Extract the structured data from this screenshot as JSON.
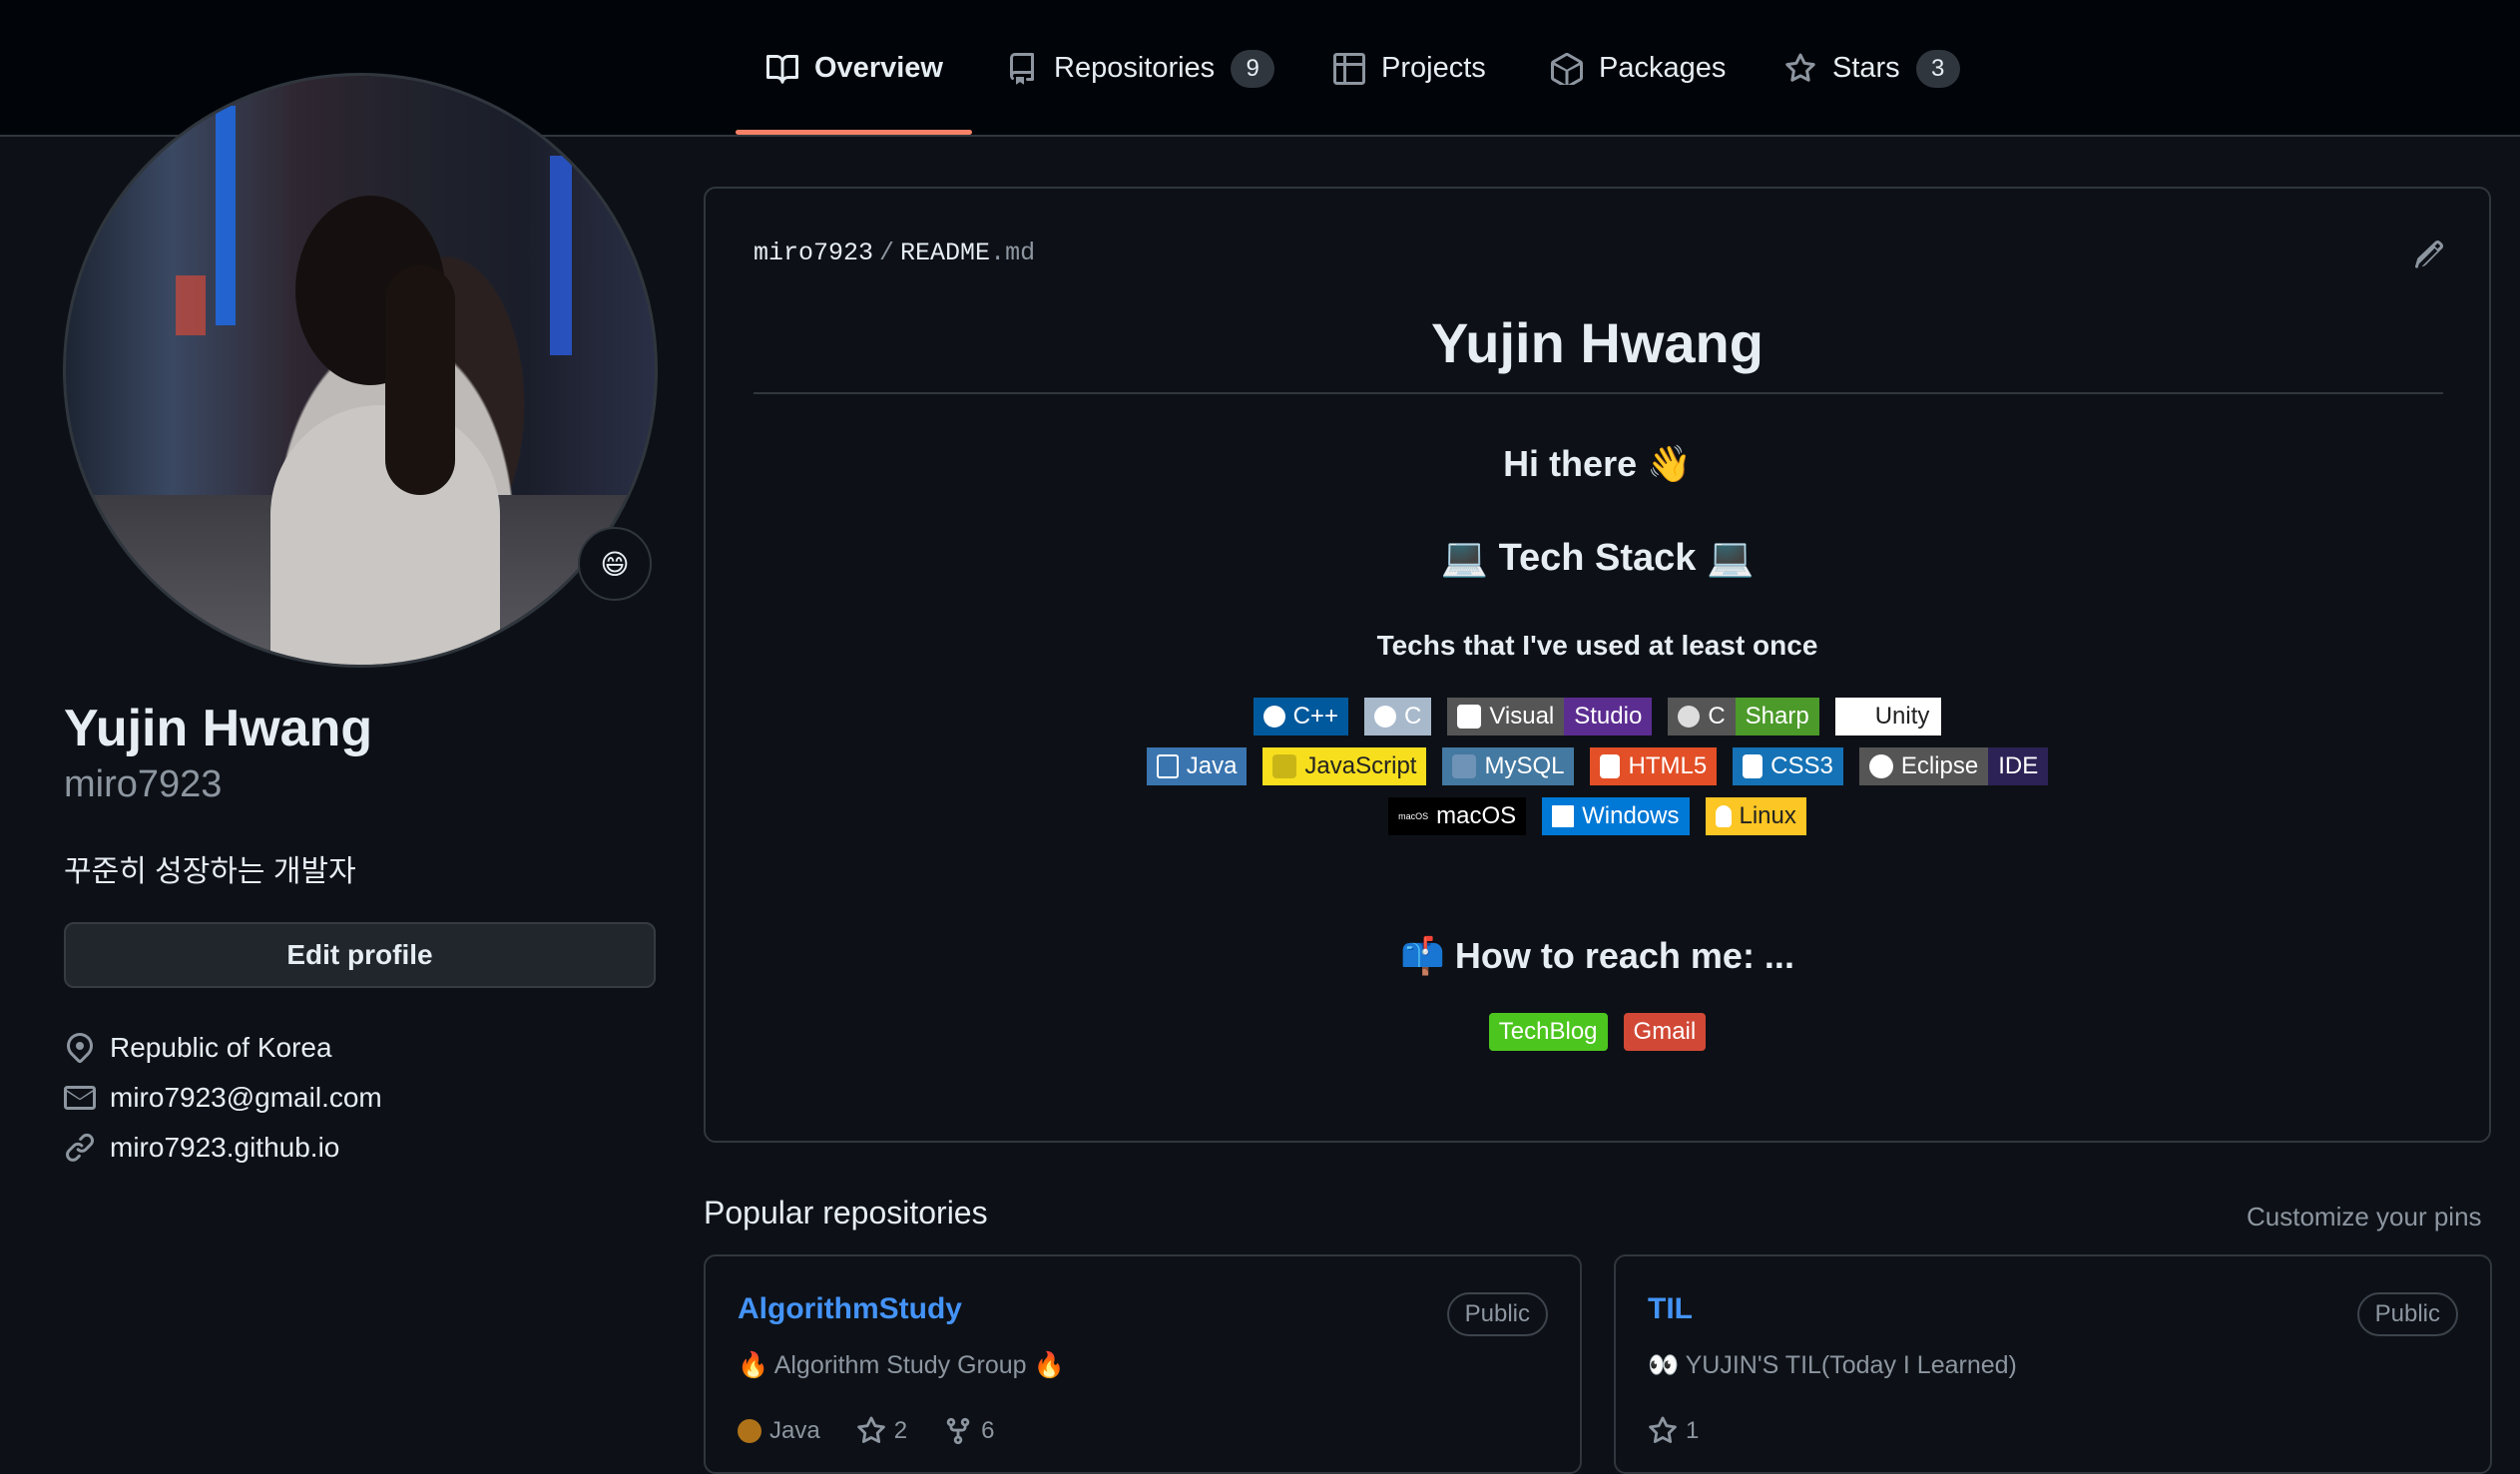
{
  "nav": {
    "tabs": [
      {
        "label": "Overview",
        "icon": "book-icon"
      },
      {
        "label": "Repositories",
        "icon": "repo-icon",
        "count": "9"
      },
      {
        "label": "Projects",
        "icon": "table-icon"
      },
      {
        "label": "Packages",
        "icon": "package-icon"
      },
      {
        "label": "Stars",
        "icon": "star-icon",
        "count": "3"
      }
    ],
    "active_color": "#f78166"
  },
  "profile": {
    "status_emoji": "😄",
    "name": "Yujin Hwang",
    "login": "miro7923",
    "bio": "꾸준히 성장하는 개발자",
    "edit_label": "Edit profile",
    "location": "Republic of Korea",
    "email": "miro7923@gmail.com",
    "website": "miro7923.github.io"
  },
  "readme": {
    "owner": "miro7923",
    "sep": "/",
    "file_base": "README",
    "file_ext": ".md",
    "title": "Yujin Hwang",
    "greeting": "Hi there 👋",
    "tech_heading": "💻 Tech Stack 💻",
    "tech_sub": "Techs that I've used at least once",
    "badges": {
      "cpp": "C++",
      "c": "C",
      "vs_a": "Visual",
      "vs_b": "Studio",
      "cs_a": "C",
      "cs_b": "Sharp",
      "unity": "Unity",
      "java": "Java",
      "js": "JavaScript",
      "mysql": "MySQL",
      "html": "HTML5",
      "css": "CSS3",
      "ecl_a": "Eclipse",
      "ecl_b": "IDE",
      "macos_ic": "macOS",
      "macos": "macOS",
      "windows": "Windows",
      "linux": "Linux"
    },
    "reach_heading": "📫 How to reach me: ...",
    "reach": {
      "techblog": "TechBlog",
      "gmail": "Gmail"
    }
  },
  "popular": {
    "title": "Popular repositories",
    "customize": "Customize your pins",
    "repos": [
      {
        "name": "AlgorithmStudy",
        "visibility": "Public",
        "description": "🔥 Algorithm Study Group 🔥",
        "language": "Java",
        "language_color": "#b07219",
        "stars": "2",
        "forks": "6"
      },
      {
        "name": "TIL",
        "visibility": "Public",
        "description": "👀 YUJIN'S TIL(Today I Learned)",
        "stars": "1"
      }
    ]
  }
}
